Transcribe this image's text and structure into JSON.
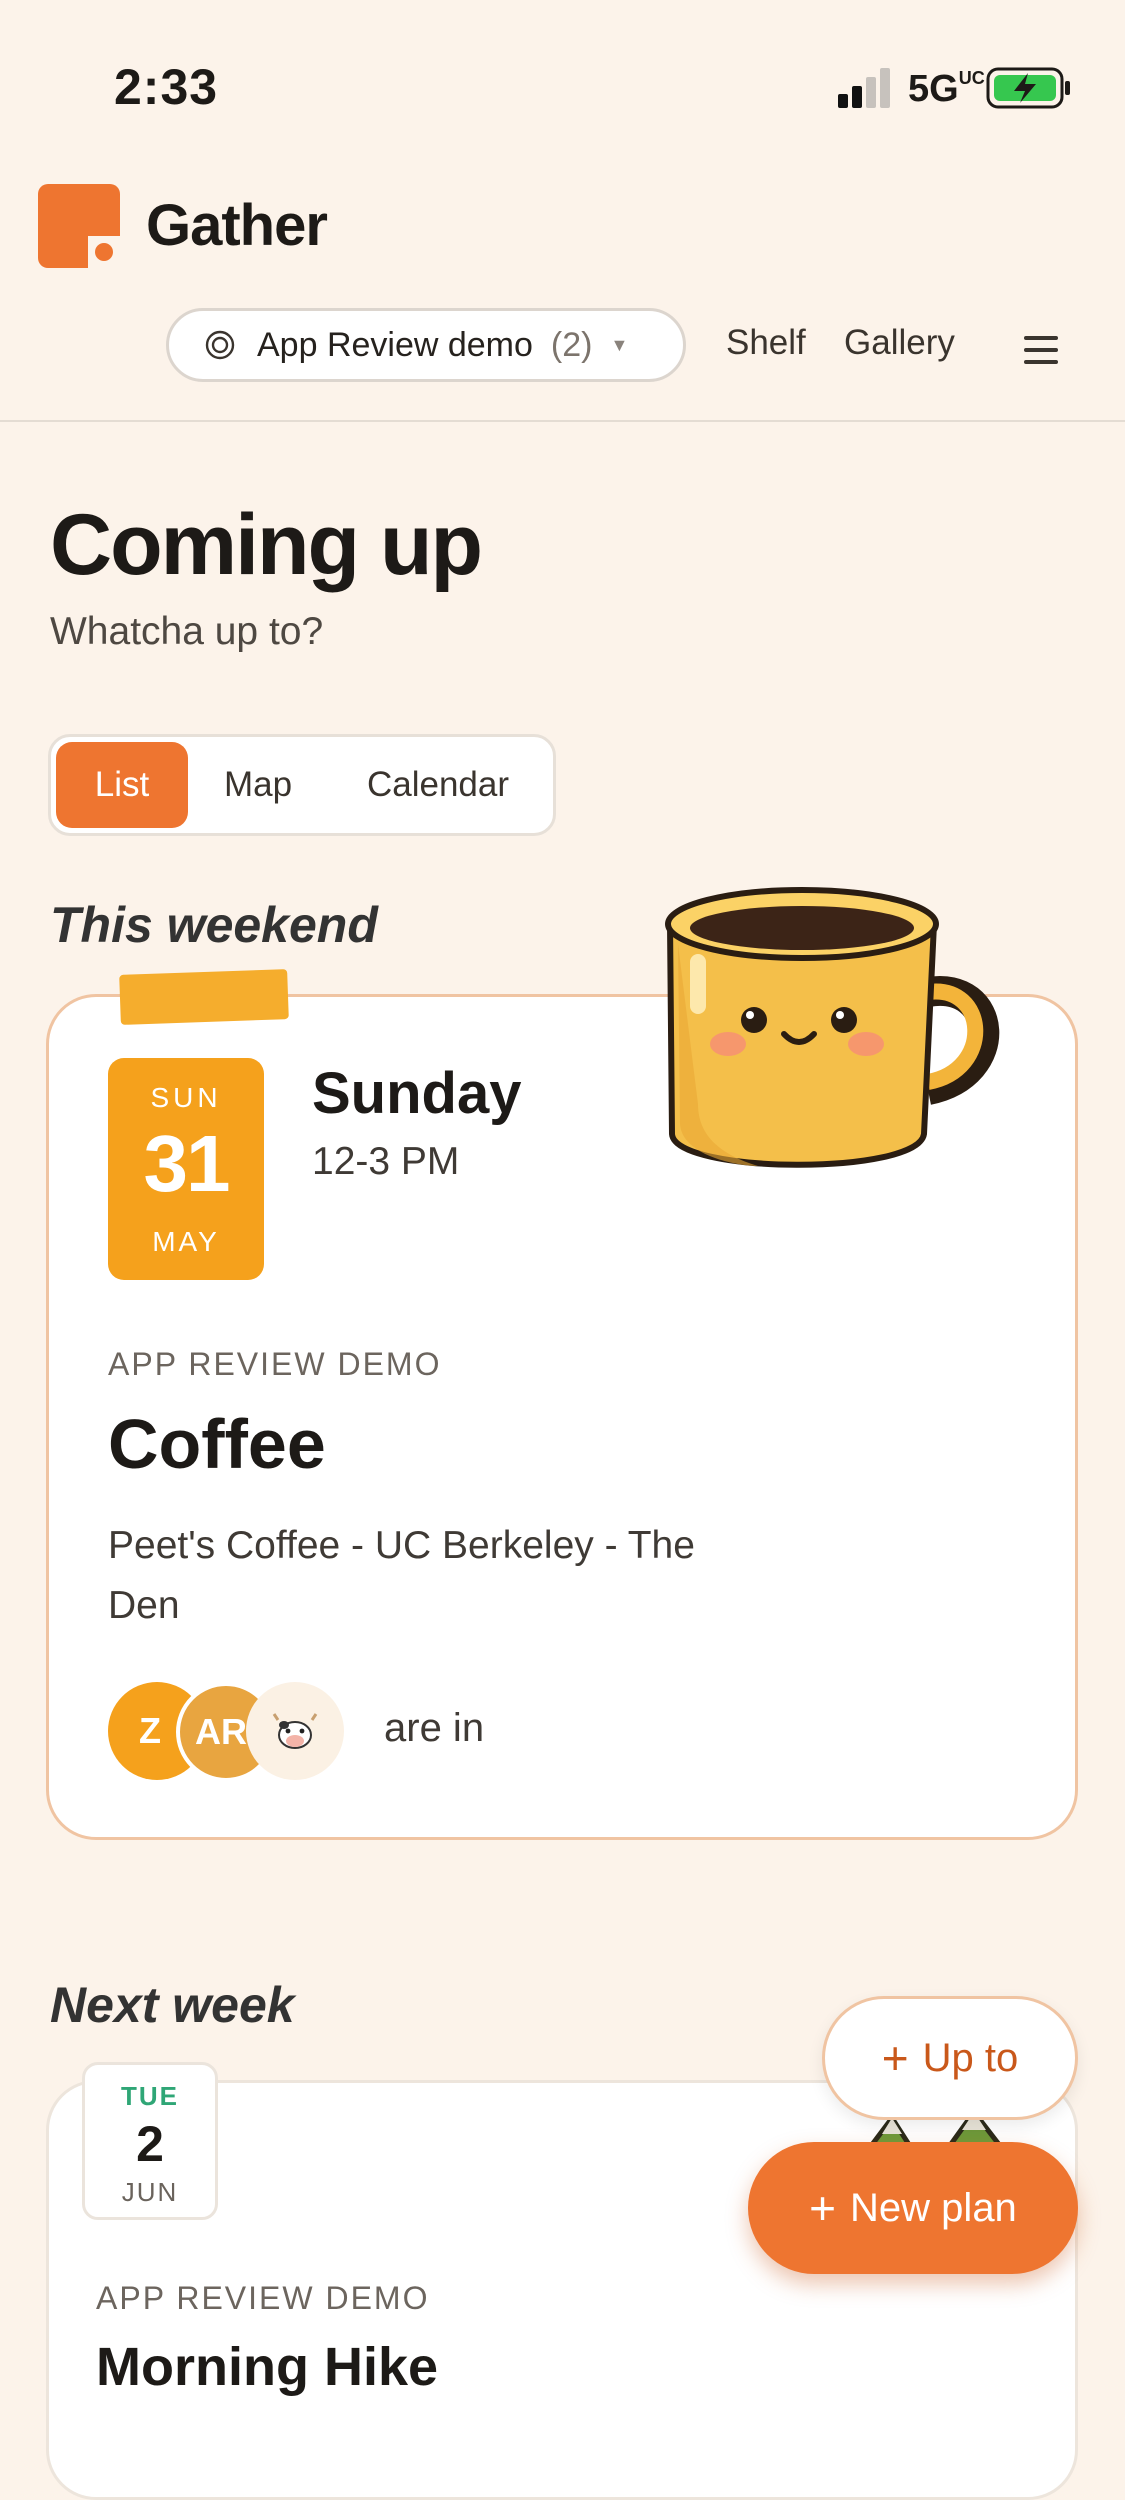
{
  "status_bar": {
    "time": "2:33",
    "network": "5G",
    "network_suffix": "UC"
  },
  "app": {
    "name": "Gather",
    "brand_color": "#ee7530"
  },
  "header": {
    "group_selector": {
      "label": "App Review demo",
      "count": "(2)"
    },
    "nav": {
      "shelf": "Shelf",
      "gallery": "Gallery"
    }
  },
  "page": {
    "title": "Coming up",
    "subtitle": "Whatcha up to?"
  },
  "view_tabs": {
    "items": [
      "List",
      "Map",
      "Calendar"
    ],
    "active": "List"
  },
  "sections": [
    {
      "heading": "This weekend",
      "event": {
        "date": {
          "dow": "SUN",
          "day": "31",
          "month": "MAY"
        },
        "day_name": "Sunday",
        "time": "12-3 PM",
        "group": "APP REVIEW DEMO",
        "title": "Coffee",
        "location": "Peet's Coffee - UC Berkeley - The Den",
        "attendees": [
          {
            "initials": "Z",
            "color": "#f5a11c"
          },
          {
            "initials": "AR",
            "color": "#e8a540"
          },
          {
            "icon": "cow-icon",
            "color": "#fbf1e4"
          }
        ],
        "attendance_text": "are in",
        "illustration": "coffee-mug-icon"
      }
    },
    {
      "heading": "Next week",
      "event": {
        "date": {
          "dow": "TUE",
          "day": "2",
          "month": "JUN"
        },
        "group": "APP REVIEW DEMO",
        "title": "Morning Hike",
        "illustration": "mountain-icon"
      }
    }
  ],
  "fab": {
    "up_to": "Up to",
    "new_plan": "New plan"
  }
}
